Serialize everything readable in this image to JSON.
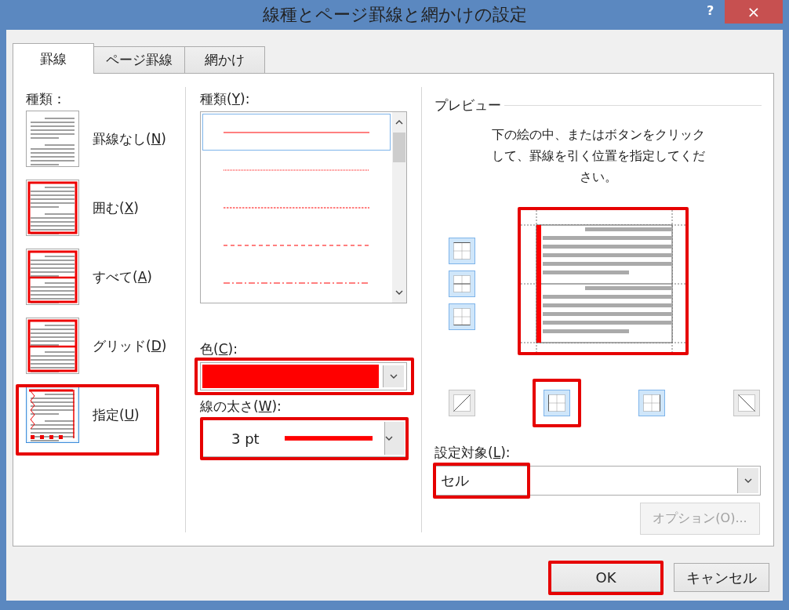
{
  "window": {
    "title": "線種とページ罫線と網かけの設定",
    "help": "?",
    "close": "×"
  },
  "tabs": [
    {
      "label": "罫線",
      "selected": true
    },
    {
      "label": "ページ罫線",
      "selected": false
    },
    {
      "label": "網かけ",
      "selected": false
    }
  ],
  "setting": {
    "label": "種類：",
    "options": [
      {
        "kind": "none",
        "label": [
          "罫線なし(",
          "N",
          ")"
        ],
        "selected": false,
        "highlighted": false
      },
      {
        "kind": "box",
        "label": [
          "囲む(",
          "X",
          ")"
        ],
        "selected": false,
        "highlighted": false
      },
      {
        "kind": "all",
        "label": [
          "すべて(",
          "A",
          ")"
        ],
        "selected": false,
        "highlighted": false
      },
      {
        "kind": "grid",
        "label": [
          "グリッド(",
          "D",
          ")"
        ],
        "selected": false,
        "highlighted": false
      },
      {
        "kind": "custom",
        "label": [
          "指定(",
          "U",
          ")"
        ],
        "selected": true,
        "highlighted": true
      }
    ]
  },
  "style": {
    "label": [
      "種類(",
      "Y",
      "):"
    ],
    "line_styles": [
      {
        "kind": "solid",
        "selected": true
      },
      {
        "kind": "dotted",
        "selected": false
      },
      {
        "kind": "fine-dashed",
        "selected": false
      },
      {
        "kind": "dashed",
        "selected": false
      },
      {
        "kind": "dash-dot",
        "selected": false
      }
    ]
  },
  "line_color": {
    "label": [
      "色(",
      "C",
      "):"
    ],
    "color": "#ff0000",
    "highlighted": true
  },
  "line_width": {
    "label": [
      "線の太さ(",
      "W",
      "):"
    ],
    "value": "3 pt",
    "highlighted": true
  },
  "preview": {
    "title": "プレビュー",
    "instructions": "下の絵の中、またはボタンをクリックして、罫線を引く位置を指定してください。",
    "highlighted": true,
    "side_buttons": [
      {
        "kind": "top",
        "on": true,
        "highlighted": false
      },
      {
        "kind": "middle",
        "on": true,
        "highlighted": false
      },
      {
        "kind": "bottom",
        "on": true,
        "highlighted": false
      }
    ],
    "bottom_buttons": [
      {
        "kind": "diagonal-up",
        "on": false,
        "highlighted": false
      },
      {
        "kind": "left",
        "on": true,
        "highlighted": true
      },
      {
        "kind": "right",
        "on": true,
        "highlighted": false
      },
      {
        "kind": "diagonal-down",
        "on": false,
        "highlighted": false
      }
    ]
  },
  "apply_to": {
    "label": [
      "設定対象(",
      "L",
      "):"
    ],
    "value": "セル",
    "highlighted": true
  },
  "options_button": {
    "label": "オプション(O)...",
    "disabled": true
  },
  "buttons": [
    {
      "label": "OK",
      "highlighted": true
    },
    {
      "label": "キャンセル",
      "highlighted": false
    }
  ]
}
